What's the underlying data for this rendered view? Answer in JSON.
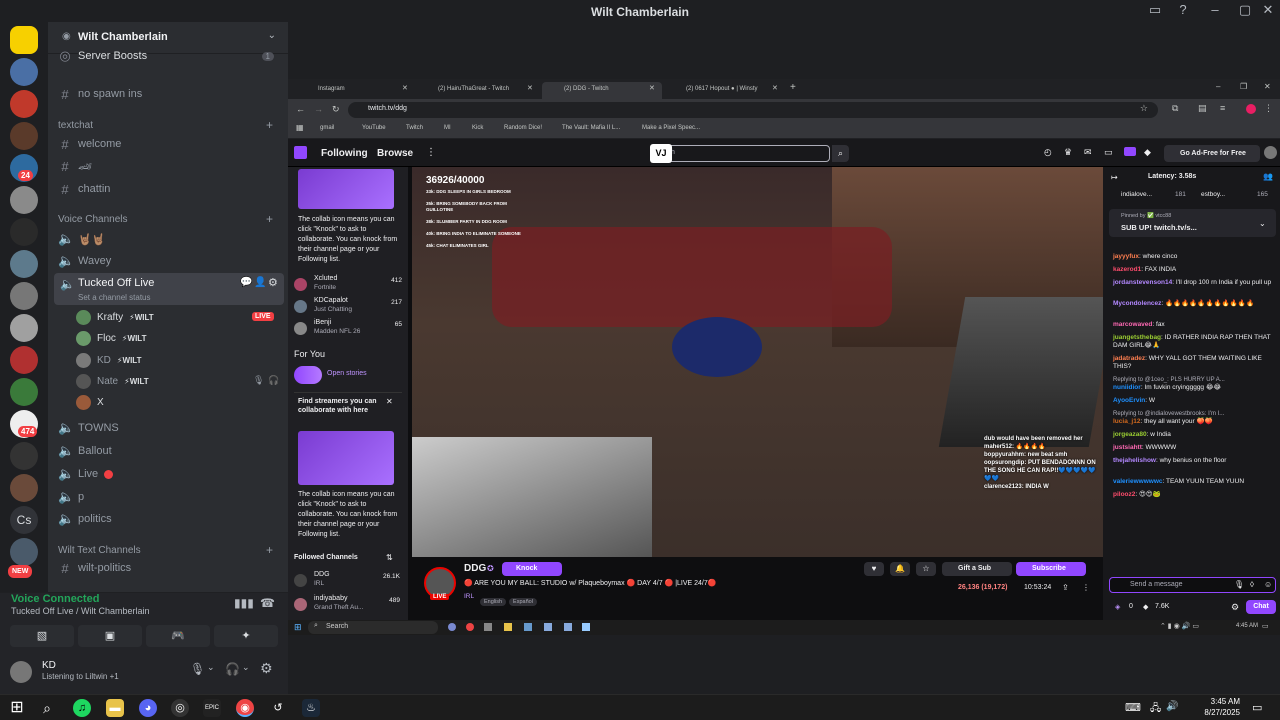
{
  "window_title": "Wilt Chamberlain",
  "server": {
    "name": "Wilt Chamberlain",
    "badges": [
      "24",
      "474",
      "NEW"
    ],
    "boosts_label": "Server Boosts",
    "boosts_count": "1"
  },
  "channels": {
    "no_spawn": "no spawn ins",
    "cat_textchat": "textchat",
    "welcome": "welcome",
    "fire_emoji": "🏎",
    "chattin": "chattin",
    "cat_voice": "Voice Channels",
    "vc_hands": "🤘🏽🤘🏽",
    "wavey": "Wavey",
    "tucked": "Tucked Off Live",
    "status": "Set a channel status",
    "users": [
      {
        "name": "Krafty",
        "tag": "⚡WILT",
        "live": "LIVE"
      },
      {
        "name": "Floc",
        "tag": "⚡WILT"
      },
      {
        "name": "KD",
        "tag": "⚡WILT"
      },
      {
        "name": "Nate",
        "tag": "⚡WILT"
      },
      {
        "name": "X",
        "tag": ""
      }
    ],
    "towns": "TOWNS",
    "ballout": "Ballout",
    "live": "Live",
    "p": "p",
    "politics": "politics",
    "cat_wilt_text": "Wilt Text Channels",
    "wilt_politics": "wilt-politics"
  },
  "voice": {
    "status": "Voice Connected",
    "location": "Tucked Off Live / Wilt Chamberlain"
  },
  "user": {
    "name": "KD",
    "activity": "Listening to Liltwin +1"
  },
  "browser": {
    "tabs": [
      "Instagram",
      "(2) HairuThaGreat - Twitch",
      "(2) DDG - Twitch",
      "(2) 0617 Hopout ● | Winsty"
    ],
    "url": "twitch.tv/ddg",
    "bookmarks": [
      "gmail",
      "YouTube",
      "Twitch",
      "MI",
      "Kick",
      "Random Dice!",
      "The Vault: Mafia II L...",
      "Make a Pixel Speec..."
    ]
  },
  "twitch": {
    "following": "Following",
    "browse": "Browse",
    "search_text": "h",
    "ad_free": "Go Ad-Free for Free",
    "sidebar": {
      "collab_text": "The collab icon means you can click \"Knock\" to ask to collaborate. You can knock from their channel page or your Following list.",
      "channels": [
        {
          "name": "Xcluted",
          "game": "Fortnite",
          "viewers": "412"
        },
        {
          "name": "KDCapalot",
          "game": "Just Chatting",
          "viewers": "217"
        },
        {
          "name": "iBenji",
          "game": "Madden NFL 26",
          "viewers": "65"
        }
      ],
      "for_you": "For You",
      "open_stories": "Open stories",
      "find_title": "Find streamers you can collaborate with here",
      "followed_title": "Followed Channels",
      "followed": [
        {
          "name": "DDG",
          "game": "IRL",
          "viewers": "26.1K"
        },
        {
          "name": "indiyababy",
          "game": "Grand Theft Au...",
          "viewers": "489"
        }
      ]
    },
    "overlay": {
      "goal": "36926/40000",
      "lines": [
        "33k: DDG SLEEPS IN GIRLS BEDROOM",
        "35k: BRING SOMEBODY BACK FROM GUILLOTINE",
        "38k: SLUMBER PARTY IN DDG ROOM",
        "40k: BRING INDIA TO ELIMINATE SOMEONE",
        "45k: CHAT ELIMINATES GIRL"
      ],
      "chat": [
        "dub would have been removed her",
        "maher512: 🔥🔥🔥🔥",
        "boppyurahhm: new beat smh",
        "oopsurongdip: PUT BENDADONNN ON THE SONG HE CAN RAP!!💙💙💙💙💙💙💙",
        "clarence2123: INDIA W"
      ]
    },
    "stream": {
      "channel": "DDG",
      "knock": "Knock",
      "title": "🔴 ARE YOU MY BALL: STUDIO w/ Plaqueboymax 🔴 DAY 4/7 🔴 |LIVE 24/7🔴",
      "category": "IRL",
      "tags": [
        "English",
        "Español"
      ],
      "gift": "Gift a Sub",
      "subscribe": "Subscribe",
      "viewers": "26,136 (19,172)",
      "uptime": "10:53:24",
      "live": "LIVE"
    },
    "chat": {
      "latency": "Latency: 3.58s",
      "top": [
        {
          "name": "indialove...",
          "count": "181"
        },
        {
          "name": "estboy...",
          "count": "165"
        }
      ],
      "pinned_by": "Pinned by ✅ vtcc88",
      "pinned_msg": "SUB UP! twitch.tv/s...",
      "messages": [
        {
          "user": "jayyyfux",
          "text": "where cinco",
          "color": "#ff7f50"
        },
        {
          "user": "kazerod1",
          "text": "FAX INDIA",
          "color": "#ff4d6d"
        },
        {
          "user": "jordanstevenson14",
          "text": "I'll drop 100 rn India if you pull up",
          "color": "#b388ff"
        },
        {
          "user": "Mycondolencez",
          "text": "🔥🔥🔥🔥🔥🔥🔥🔥🔥🔥🔥",
          "color": "#b388ff"
        },
        {
          "user": "marcowaved",
          "text": "fax",
          "color": "#ff69b4"
        },
        {
          "user": "juangetsthebag",
          "text": "ID RATHER INDIA RAP THEN THAT DAM GIRL😂🙏",
          "color": "#9acd32"
        },
        {
          "user": "jadatradez",
          "text": "WHY YALL GOT THEM WAITING LIKE THIS?",
          "color": "#ff7f50"
        },
        {
          "user": "nuniidior",
          "text": "Im fuvkin cryinggggg 😂😂",
          "color": "#1e90ff",
          "reply": "Replying to @1ceo_: PLS HURRY UP A..."
        },
        {
          "user": "AyooErvin",
          "text": "W",
          "color": "#1e90ff"
        },
        {
          "user": "lucia_j12",
          "text": "they all want your 🍑🍑",
          "color": "#d2691e",
          "reply": "Replying to @indialovewestbrooks: I'm I..."
        },
        {
          "user": "jorgeaza80",
          "text": "w India",
          "color": "#9acd32"
        },
        {
          "user": "justsiahtt",
          "text": "WWWWW",
          "color": "#ff69b4"
        },
        {
          "user": "thejahelishow",
          "text": "why benius on the floor",
          "color": "#b388ff"
        },
        {
          "user": "valeriewwwwwc",
          "text": "TEAM YUUN TEAM YUUN",
          "color": "#1e90ff"
        },
        {
          "user": "pilooz2",
          "text": "😍😍🐸",
          "color": "#ff4d6d"
        }
      ],
      "placeholder": "Send a message",
      "points": "0",
      "bits": "7.6K",
      "chat_btn": "Chat"
    }
  },
  "inner_taskbar": {
    "search": "Search",
    "time": "4:45 AM"
  },
  "taskbar": {
    "time": "3:45 AM",
    "date": "8/27/2025"
  }
}
